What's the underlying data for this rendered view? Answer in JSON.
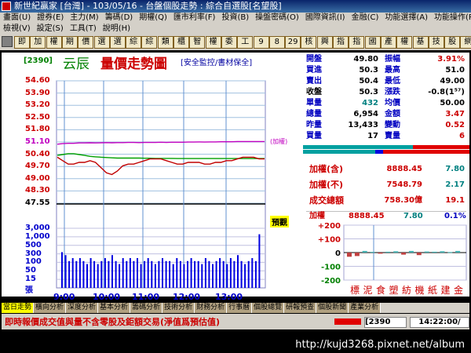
{
  "window": {
    "title": "新世紀贏家 [台灣] - 103/05/16 - 台盤個股走勢 : 綜合自選股[名望股]"
  },
  "menu1": [
    "畫面(U)",
    "證券(E)",
    "主力(M)",
    "籌碼(D)",
    "期權(Q)",
    "匯市利率(F)",
    "投資(B)",
    "操盤密碼(O)",
    "國際資訊(I)",
    "金融(C)",
    "功能選擇(A)",
    "功能操作(P)"
  ],
  "menu2": [
    "檢視(V)",
    "設定(S)",
    "工具(T)",
    "說明(H)"
  ],
  "toolbar": [
    "即",
    "加",
    "權",
    "期",
    "價",
    "選",
    "選",
    "綜",
    "綜",
    "類",
    "櫃",
    "智",
    "權",
    "委",
    "工",
    "9",
    "8",
    "29",
    "核",
    "興",
    "指",
    "指",
    "國",
    "產",
    "權",
    "基",
    "技",
    "股",
    "網"
  ],
  "stock": {
    "code": "[2390]",
    "name": "云辰",
    "chart_title": "量價走勢圖",
    "tag": "[安全監控/書材保全]",
    "marker": "(加權)",
    "window_btn": "預觀"
  },
  "chart_data": {
    "type": "line",
    "price_ticks": [
      "54.60",
      "53.90",
      "53.20",
      "52.50",
      "51.80",
      "51.10",
      "50.40",
      "49.70",
      "49.00",
      "48.30",
      "47.55"
    ],
    "volume_ticks": [
      "3,000",
      "1,000",
      "500",
      "300",
      "100",
      "50",
      "15",
      "張"
    ],
    "time_ticks": [
      "9:00",
      "10:00",
      "11:00",
      "12:00",
      "13:00"
    ],
    "price_series": [
      50.2,
      50.0,
      49.8,
      49.8,
      49.9,
      49.9,
      50.0,
      49.9,
      49.6,
      49.3,
      49.2,
      49.4,
      49.7,
      49.8,
      49.8,
      49.9,
      50.0,
      50.1,
      50.1,
      50.1,
      50.0,
      49.9,
      49.8,
      49.8,
      49.9,
      49.9,
      49.9,
      49.8,
      49.8,
      49.9,
      49.9,
      50.0,
      50.0,
      50.1,
      50.2,
      50.2,
      50.2,
      50.1,
      50.1
    ],
    "avg_series": [
      50.3,
      50.35,
      50.4,
      50.4,
      50.35,
      50.3,
      50.25,
      50.22,
      50.2,
      50.18,
      50.16,
      50.15,
      50.15,
      50.15,
      50.15,
      50.15,
      50.14,
      50.14,
      50.13,
      50.13,
      50.13,
      50.13,
      50.12,
      50.12,
      50.12,
      50.12,
      50.12,
      50.12,
      50.12,
      50.12,
      50.12,
      50.12,
      50.12,
      50.12,
      50.12,
      50.12,
      50.12,
      50.12,
      50.12
    ],
    "index_series": [
      50.95,
      50.98,
      51.0,
      51.0,
      51.02,
      51.02,
      51.03,
      51.02,
      51.03,
      51.04,
      51.03,
      51.04,
      51.04,
      51.05,
      51.05,
      51.04,
      51.05,
      51.05,
      51.05,
      51.06,
      51.05,
      51.06,
      51.06,
      51.06,
      51.07,
      51.07,
      51.08,
      51.07,
      51.08,
      51.08,
      51.09,
      51.09,
      51.09,
      51.1,
      51.1,
      51.1,
      51.1,
      51.1,
      51.1
    ],
    "volume": [
      60,
      55,
      45,
      50,
      45,
      50,
      45,
      40,
      50,
      45,
      40,
      45,
      50,
      45,
      55,
      45,
      40,
      50,
      45,
      50,
      45,
      50,
      40,
      45,
      50,
      45,
      40,
      45,
      50,
      45,
      45,
      40,
      50,
      45,
      40,
      45,
      50,
      45,
      45,
      40,
      50,
      45,
      40,
      45,
      50,
      45,
      40,
      50,
      45,
      55,
      45,
      40,
      45,
      50,
      45,
      90
    ],
    "price_range": [
      47.55,
      54.6
    ],
    "colors": {
      "price": "#c00000",
      "avg": "#00a000",
      "index": "#c000c0",
      "volume": "#0000e0"
    }
  },
  "quote": {
    "rows": [
      {
        "l1": "開盤",
        "v1": "49.80",
        "l2": "振幅",
        "v2": "3.91%"
      },
      {
        "l1": "買進",
        "v1": "50.3",
        "l2": "最高",
        "v2": "51.0"
      },
      {
        "l1": "賣出",
        "v1": "50.4",
        "l2": "最低",
        "v2": "49.00"
      },
      {
        "l1": "收盤",
        "v1": "50.3",
        "l2": "漲跌",
        "v2": "-0.8(1⁵⁷)"
      },
      {
        "l1": "單量",
        "v1": "432",
        "l2": "均價",
        "v2": "50.00"
      },
      {
        "l1": "總量",
        "v1": "6,954",
        "l2": "金額",
        "v2": "3.47"
      },
      {
        "l1": "昨量",
        "v1": "13,433",
        "l2": "變動",
        "v2": "0.52"
      },
      {
        "l1": "買量",
        "v1": "17",
        "l2": "賣量",
        "v2": "6"
      }
    ]
  },
  "index_box": {
    "rows": [
      {
        "label": "加權(含)",
        "value": "8888.45",
        "change": "7.80"
      },
      {
        "label": "加權(不)",
        "value": "7548.79",
        "change": "2.17"
      },
      {
        "label": "成交總額",
        "value": "758.30億",
        "change": "19.1"
      }
    ]
  },
  "mini": {
    "label": "加權",
    "value": "8888.45",
    "change": "7.80",
    "pct": "0.1%",
    "yticks": [
      "+200",
      "+100",
      "0",
      "-100",
      "-200"
    ],
    "sectors": [
      "標",
      "泥",
      "食",
      "塑",
      "紡",
      "機",
      "紙",
      "建",
      "金"
    ],
    "bars": [
      -30,
      -25,
      12,
      5,
      -8,
      6,
      10,
      -15,
      12,
      -18,
      8,
      6,
      10,
      4,
      12
    ],
    "yrange": [
      -200,
      200
    ]
  },
  "tabs": [
    "當日走勢",
    "橫向分析",
    "深度分析",
    "基本分析",
    "籌碼分析",
    "技術分析",
    "財務分析",
    "行事曆",
    "個股總覽",
    "研報預查",
    "個股新聞",
    "產業分析"
  ],
  "status": {
    "marquee": "即時報價成交值與量不含零股及鉅額交易(淨值爲預估值)",
    "code": "2390",
    "time": "14:22:00/"
  },
  "taskbar": {
    "url": "http://kujd3268.pixnet.net/album"
  }
}
